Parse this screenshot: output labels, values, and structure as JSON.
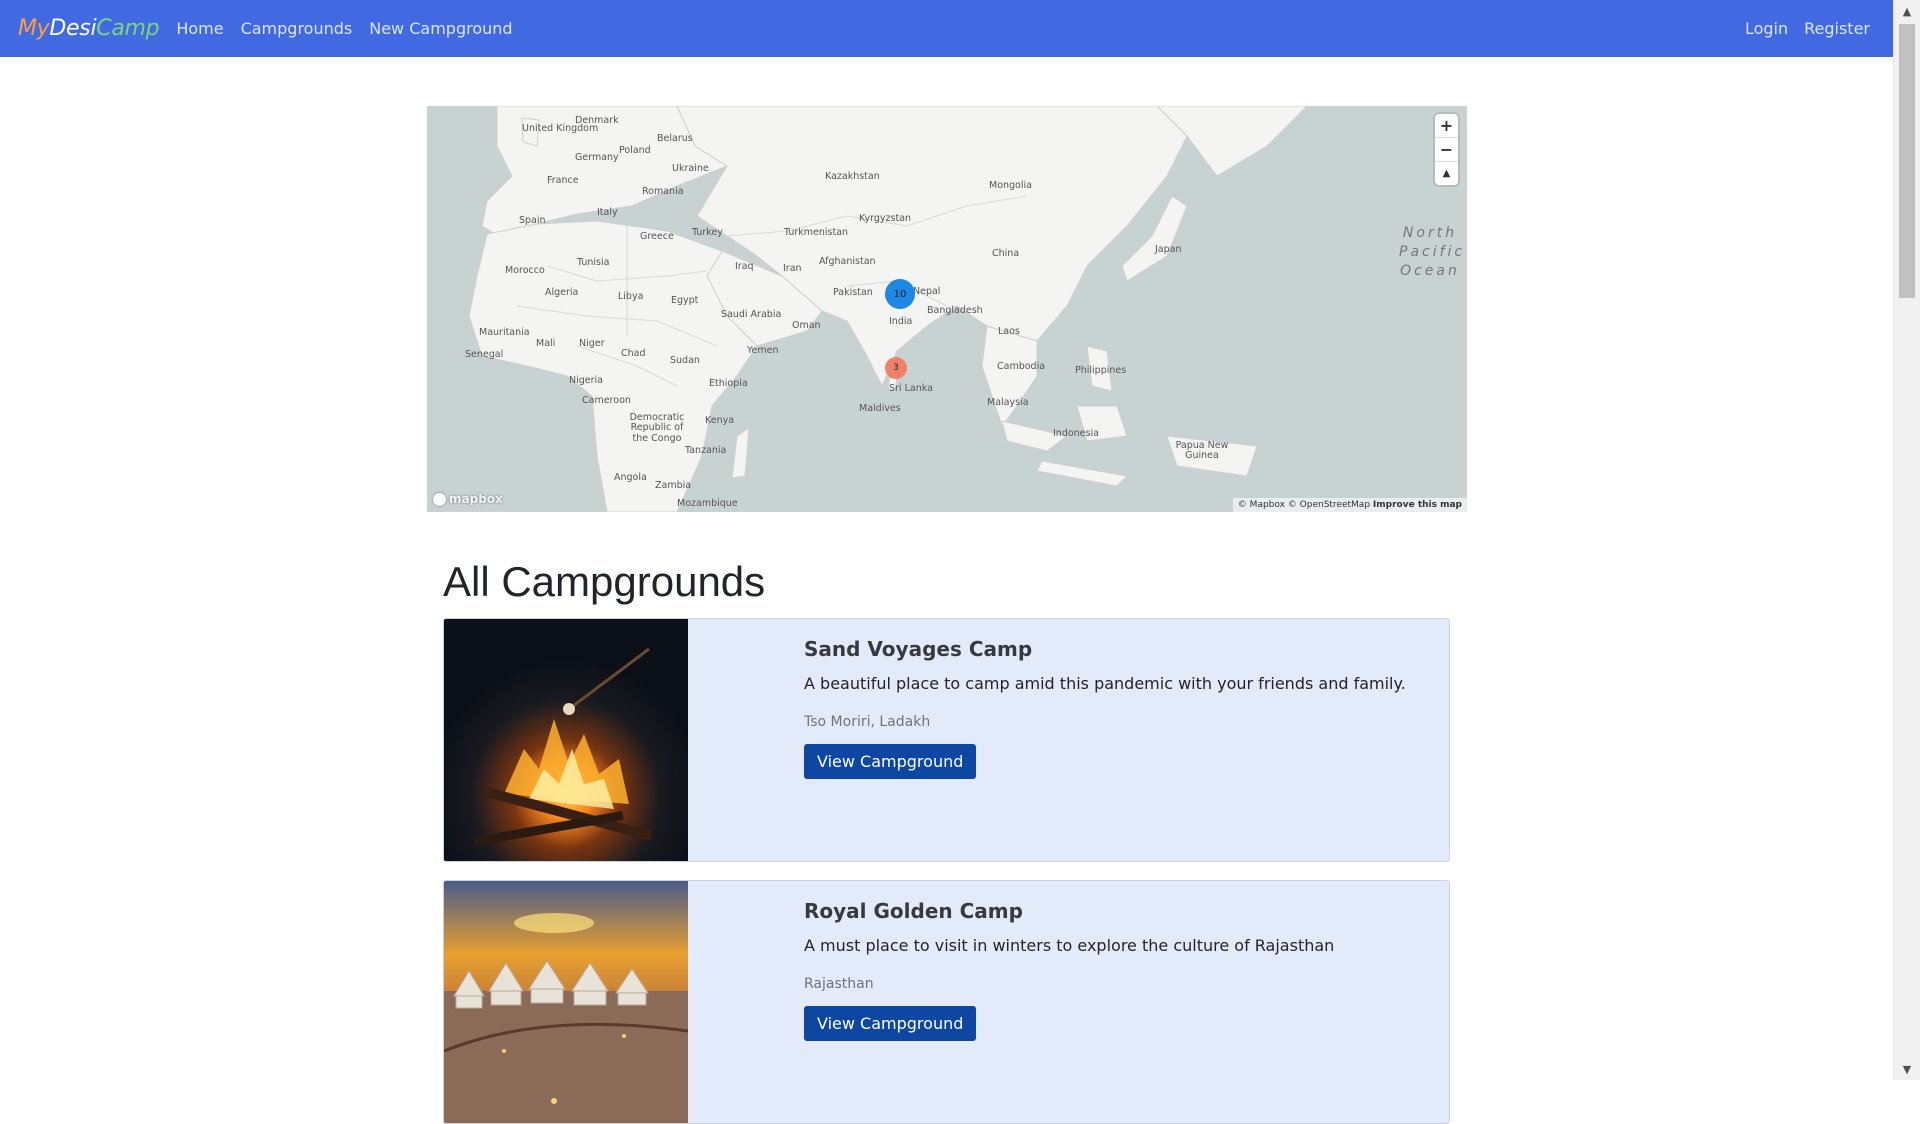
{
  "brand": {
    "part1": "My",
    "part2": "Desi",
    "part3": "Camp"
  },
  "nav": {
    "links": [
      "Home",
      "Campgrounds",
      "New Campground"
    ],
    "right": [
      "Login",
      "Register"
    ]
  },
  "map": {
    "countries": [
      "United Kingdom",
      "Denmark",
      "Belarus",
      "Poland",
      "Germany",
      "Ukraine",
      "France",
      "Romania",
      "Italy",
      "Spain",
      "Greece",
      "Turkey",
      "Kazakhstan",
      "Mongolia",
      "Kyrgyzstan",
      "Turkmenistan",
      "Morocco",
      "Tunisia",
      "Iraq",
      "Iran",
      "Afghanistan",
      "China",
      "Japan",
      "Algeria",
      "Libya",
      "Egypt",
      "Pakistan",
      "Nepal",
      "Saudi Arabia",
      "India",
      "Bangladesh",
      "Mauritania",
      "Mali",
      "Niger",
      "Oman",
      "Laos",
      "Senegal",
      "Chad",
      "Sudan",
      "Yemen",
      "Cambodia",
      "Philippines",
      "Nigeria",
      "Ethiopia",
      "Sri Lanka",
      "Cameroon",
      "Malaysia",
      "Democratic Republic of the Congo",
      "Maldives",
      "Kenya",
      "Indonesia",
      "Tanzania",
      "Papua New Guinea",
      "Angola",
      "Zambia",
      "Mozambique"
    ],
    "ocean": "North Pacific Ocean",
    "clusters": [
      {
        "count": "10",
        "color": "#1e88e5"
      },
      {
        "count": "3",
        "color": "#f28068"
      }
    ],
    "controls": {
      "zoom_in": "+",
      "zoom_out": "−",
      "reset": "▲"
    },
    "logo": "mapbox",
    "attribution": "© Mapbox © OpenStreetMap",
    "improve": "Improve this map"
  },
  "heading": "All Campgrounds",
  "campgrounds": [
    {
      "title": "Sand Voyages Camp",
      "description": "A beautiful place to camp amid this pandemic with your friends and family.",
      "location": "Tso Moriri, Ladakh",
      "button": "View Campground"
    },
    {
      "title": "Royal Golden Camp",
      "description": "A must place to visit in winters to explore the culture of Rajasthan",
      "location": "Rajasthan",
      "button": "View Campground"
    }
  ],
  "colors": {
    "navbar": "#4169e1",
    "card_bg": "#e3ebfb",
    "button": "#0d47a1"
  },
  "icons": {
    "zoom_in": "plus-icon",
    "zoom_out": "minus-icon",
    "compass": "compass-icon",
    "scroll_up": "chevron-up-icon",
    "scroll_down": "chevron-down-icon"
  }
}
